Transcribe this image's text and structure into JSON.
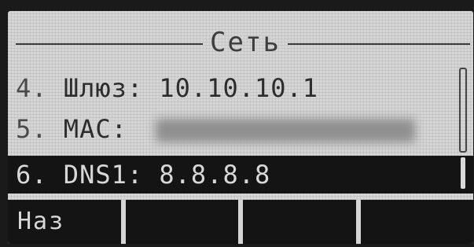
{
  "screen": {
    "title": "Сеть"
  },
  "menu": {
    "items": [
      {
        "number": "4.",
        "label": "Шлюз:",
        "value": "10.10.10.1"
      },
      {
        "number": "5.",
        "label": "MAC:",
        "value": ""
      },
      {
        "number": "6.",
        "label": "DNS1:",
        "value": "8.8.8.8"
      }
    ],
    "selected_index": 2
  },
  "softkeys": [
    {
      "label": "Наз"
    },
    {
      "label": ""
    },
    {
      "label": ""
    },
    {
      "label": ""
    }
  ],
  "colors": {
    "screen_bg": "#d5d5d5",
    "highlight_bg": "#141414",
    "highlight_text": "#d8d8d8",
    "text": "#2c2c2c"
  }
}
